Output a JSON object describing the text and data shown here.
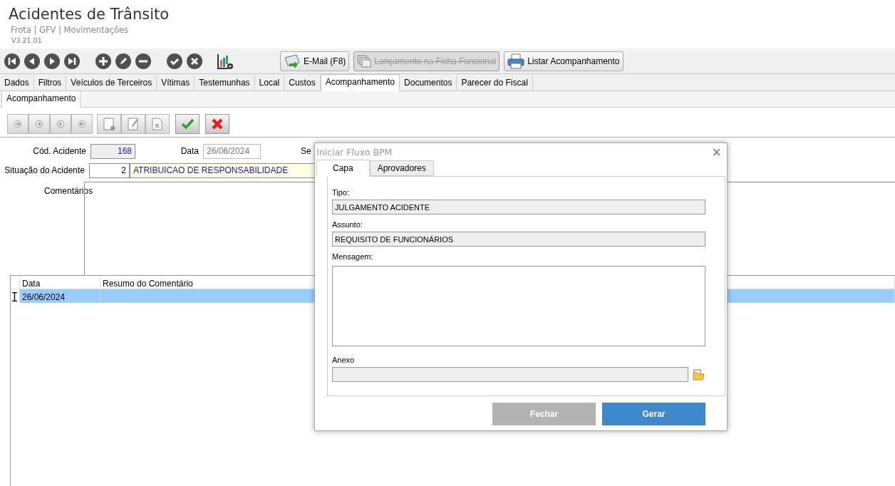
{
  "header": {
    "title": "Acidentes de Trânsito",
    "breadcrumb": "Frota | GFV | Movimentações",
    "version": "V3.21.01"
  },
  "toolbar_buttons": [
    {
      "label": "E-Mail (F8)",
      "kind": "email",
      "disabled": false
    },
    {
      "label": "Lançamento na Ficha Funcional",
      "kind": "copy",
      "disabled": true
    },
    {
      "label": "Listar Acompanhamento",
      "kind": "print",
      "disabled": false
    }
  ],
  "tabs": [
    {
      "label": "Dados",
      "selected": false
    },
    {
      "label": "Filtros",
      "selected": false
    },
    {
      "label": "Veículos de Terceiros",
      "selected": false
    },
    {
      "label": "Vítimas",
      "selected": false
    },
    {
      "label": "Testemunhas",
      "selected": false
    },
    {
      "label": "Local",
      "selected": false
    },
    {
      "label": "Custos",
      "selected": false
    },
    {
      "label": "Acompanhamento",
      "selected": true
    },
    {
      "label": "Documentos",
      "selected": false
    },
    {
      "label": "Parecer do Fiscal",
      "selected": false
    }
  ],
  "subtabs": [
    {
      "label": "Acompanhamento",
      "selected": true
    }
  ],
  "record_toolbar": [
    {
      "kind": "first",
      "disabled": true
    },
    {
      "kind": "prev",
      "disabled": true
    },
    {
      "kind": "next",
      "disabled": true
    },
    {
      "kind": "last",
      "disabled": true
    },
    {
      "kind": "new",
      "disabled": true
    },
    {
      "kind": "edit",
      "disabled": true
    },
    {
      "kind": "delete",
      "disabled": true
    },
    {
      "kind": "confirm",
      "disabled": false
    },
    {
      "kind": "cancel",
      "disabled": false
    }
  ],
  "form": {
    "cod_acidente": {
      "label": "Cód. Acidente",
      "value": "168"
    },
    "data": {
      "label": "Data",
      "value": "26/06/2024"
    },
    "label_3": "Se",
    "situacao": {
      "label": "Situação do Acidente",
      "code": "2",
      "description": "ATRIBUICAO DE RESPONSABILIDADE"
    },
    "comentarios": {
      "label": "Comentários"
    }
  },
  "grid": {
    "columns": [
      "Data",
      "Resumo do Comentário"
    ],
    "rows": [
      {
        "data": "26/06/2024",
        "selected": true
      }
    ]
  },
  "dialog": {
    "title": "Iniciar Fluxo BPM",
    "close": "×",
    "tabs": [
      {
        "label": "Capa",
        "selected": true
      },
      {
        "label": "Aprovadores",
        "selected": false
      }
    ],
    "fields": [
      {
        "label": "Tipo:",
        "value": "JULGAMENTO ACIDENTE",
        "kind": "text"
      },
      {
        "label": "Assunto:",
        "value": "REQUISITO DE FUNCIONÁRIOS",
        "kind": "text"
      },
      {
        "label": "Mensagem:",
        "kind": "memo"
      },
      {
        "label": "Anexo",
        "kind": "file"
      }
    ],
    "buttons": [
      {
        "label": "Fechar",
        "kind": "secondary"
      },
      {
        "label": "Gerar",
        "kind": "primary"
      }
    ]
  }
}
